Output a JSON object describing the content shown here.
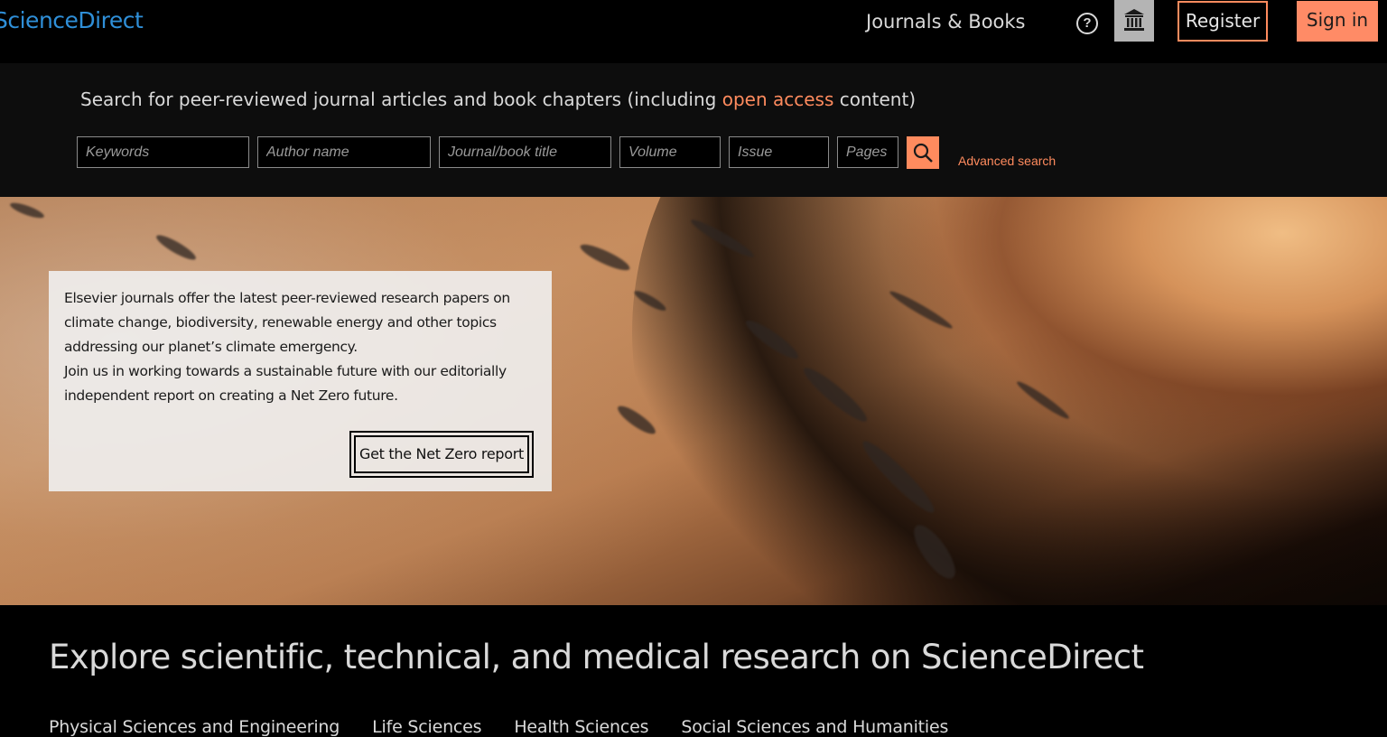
{
  "header": {
    "logo": "ScienceDirect",
    "nav_journals": "Journals & Books",
    "help_icon": "question-circle-icon",
    "institution_icon": "institution-building-icon",
    "register": "Register",
    "sign_in": "Sign in"
  },
  "search": {
    "intro_before": "Search for peer-reviewed journal articles and book chapters (including ",
    "intro_link": "open access",
    "intro_after": " content)",
    "keywords_placeholder": "Keywords",
    "author_placeholder": "Author name",
    "journal_placeholder": "Journal/book title",
    "volume_placeholder": "Volume",
    "issue_placeholder": "Issue",
    "pages_placeholder": "Pages",
    "search_icon": "search-icon",
    "advanced": "Advanced search"
  },
  "hero": {
    "line1": "Elsevier journals offer the latest peer-reviewed research papers on",
    "line2": "climate change, biodiversity, renewable energy and other topics",
    "line3": "addressing our planet’s climate emergency.",
    "line4": "Join us in working towards a sustainable future with our editorially",
    "line5": "independent report on creating a Net Zero future.",
    "button": "Get the Net Zero report"
  },
  "explore": {
    "title": "Explore scientific, technical, and medical research on ScienceDirect",
    "tabs": [
      "Physical Sciences and Engineering",
      "Life Sciences",
      "Health Sciences",
      "Social Sciences and Humanities"
    ]
  },
  "colors": {
    "accent": "#ff8b5e",
    "logo": "#2f8fd8",
    "background": "#000000"
  }
}
